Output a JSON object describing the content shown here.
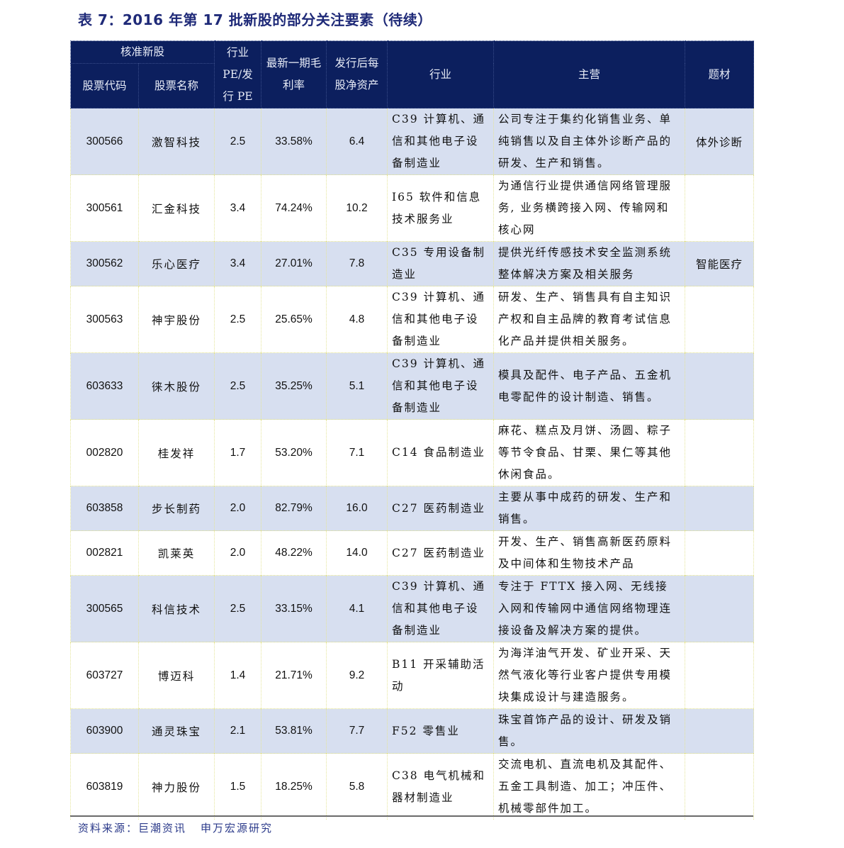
{
  "title": "表 7：2016 年第 17 批新股的部分关注要素（待续）",
  "header": {
    "group_label": "核准新股",
    "code_label": "股票代码",
    "name_label": "股票名称",
    "pe_label": "行业 PE/发行 PE",
    "margin_label": "最新一期毛利率",
    "nav_label": "发行后每股净资产",
    "industry_label": "行业",
    "business_label": "主营",
    "theme_label": "题材"
  },
  "rows": [
    {
      "code": "300566",
      "name": "激智科技",
      "pe": "2.5",
      "margin": "33.58%",
      "nav": "6.4",
      "industry": "C39 计算机、通信和其他电子设备制造业",
      "business": "公司专注于集约化销售业务、单纯销售以及自主体外诊断产品的研发、生产和销售。",
      "theme": "体外诊断"
    },
    {
      "code": "300561",
      "name": "汇金科技",
      "pe": "3.4",
      "margin": "74.24%",
      "nav": "10.2",
      "industry": "I65 软件和信息技术服务业",
      "business": "为通信行业提供通信网络管理服务, 业务横跨接入网、传输网和核心网",
      "theme": ""
    },
    {
      "code": "300562",
      "name": "乐心医疗",
      "pe": "3.4",
      "margin": "27.01%",
      "nav": "7.8",
      "industry": "C35 专用设备制造业",
      "business": "提供光纤传感技术安全监测系统整体解决方案及相关服务",
      "theme": "智能医疗"
    },
    {
      "code": "300563",
      "name": "神宇股份",
      "pe": "2.5",
      "margin": "25.65%",
      "nav": "4.8",
      "industry": "C39 计算机、通信和其他电子设备制造业",
      "business": "研发、生产、销售具有自主知识产权和自主品牌的教育考试信息化产品并提供相关服务。",
      "theme": ""
    },
    {
      "code": "603633",
      "name": "徕木股份",
      "pe": "2.5",
      "margin": "35.25%",
      "nav": "5.1",
      "industry": "C39 计算机、通信和其他电子设备制造业",
      "business": "模具及配件、电子产品、五金机电零配件的设计制造、销售。",
      "theme": ""
    },
    {
      "code": "002820",
      "name": "桂发祥",
      "pe": "1.7",
      "margin": "53.20%",
      "nav": "7.1",
      "industry": "C14 食品制造业",
      "business": "麻花、糕点及月饼、汤圆、粽子等节令食品、甘栗、果仁等其他休闲食品。",
      "theme": ""
    },
    {
      "code": "603858",
      "name": "步长制药",
      "pe": "2.0",
      "margin": "82.79%",
      "nav": "16.0",
      "industry": "C27 医药制造业",
      "business": "主要从事中成药的研发、生产和销售。",
      "theme": ""
    },
    {
      "code": "002821",
      "name": "凯莱英",
      "pe": "2.0",
      "margin": "48.22%",
      "nav": "14.0",
      "industry": "C27 医药制造业",
      "business": "开发、生产、销售高新医药原料及中间体和生物技术产品",
      "theme": ""
    },
    {
      "code": "300565",
      "name": "科信技术",
      "pe": "2.5",
      "margin": "33.15%",
      "nav": "4.1",
      "industry": "C39 计算机、通信和其他电子设备制造业",
      "business": "专注于 FTTX 接入网、无线接入网和传输网中通信网络物理连接设备及解决方案的提供。",
      "theme": ""
    },
    {
      "code": "603727",
      "name": "博迈科",
      "pe": "1.4",
      "margin": "21.71%",
      "nav": "9.2",
      "industry": "B11 开采辅助活动",
      "business": "为海洋油气开发、矿业开采、天然气液化等行业客户提供专用模块集成设计与建造服务。",
      "theme": ""
    },
    {
      "code": "603900",
      "name": "通灵珠宝",
      "pe": "2.1",
      "margin": "53.81%",
      "nav": "7.7",
      "industry": "F52 零售业",
      "business": "珠宝首饰产品的设计、研发及销售。",
      "theme": ""
    },
    {
      "code": "603819",
      "name": "神力股份",
      "pe": "1.5",
      "margin": "18.25%",
      "nav": "5.8",
      "industry": "C38 电气机械和器材制造业",
      "business": "交流电机、直流电机及其配件、五金工具制造、加工；冲压件、机械零部件加工。",
      "theme": ""
    }
  ],
  "source": {
    "label": "资料来源：巨潮资讯",
    "org": "申万宏源研究"
  }
}
